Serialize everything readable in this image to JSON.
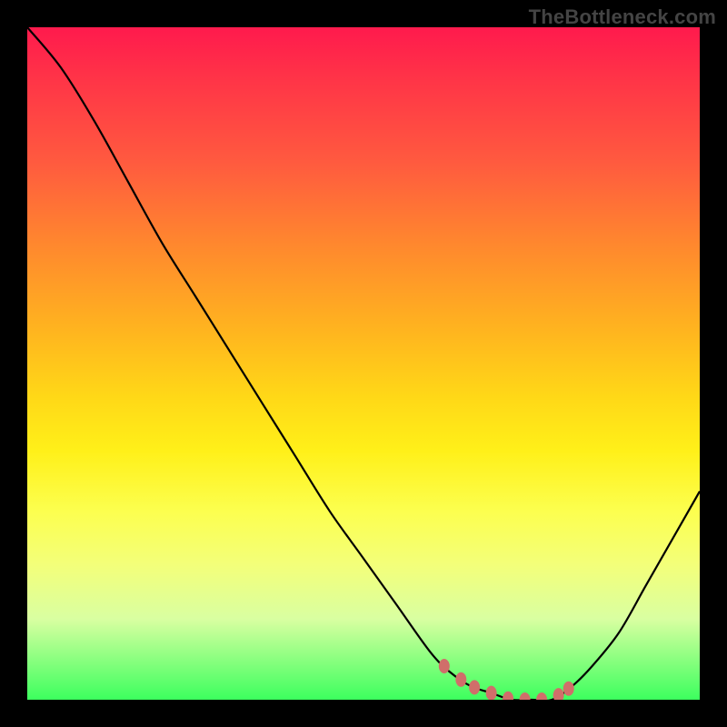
{
  "watermark": "TheBottleneck.com",
  "chart_data": {
    "type": "line",
    "title": "",
    "xlabel": "",
    "ylabel": "",
    "xlim": [
      0,
      1
    ],
    "ylim": [
      0,
      1
    ],
    "x": [
      0.0,
      0.05,
      0.1,
      0.15,
      0.2,
      0.25,
      0.3,
      0.35,
      0.4,
      0.45,
      0.5,
      0.55,
      0.6,
      0.63,
      0.66,
      0.69,
      0.72,
      0.75,
      0.78,
      0.81,
      0.84,
      0.88,
      0.92,
      0.96,
      1.0
    ],
    "y": [
      1.0,
      0.94,
      0.86,
      0.77,
      0.68,
      0.6,
      0.52,
      0.44,
      0.36,
      0.28,
      0.21,
      0.14,
      0.07,
      0.04,
      0.02,
      0.01,
      0.0,
      0.0,
      0.0,
      0.02,
      0.05,
      0.1,
      0.17,
      0.24,
      0.31
    ],
    "trough_markers_x": [
      0.62,
      0.645,
      0.665,
      0.69,
      0.715,
      0.74,
      0.765,
      0.79,
      0.805
    ]
  }
}
